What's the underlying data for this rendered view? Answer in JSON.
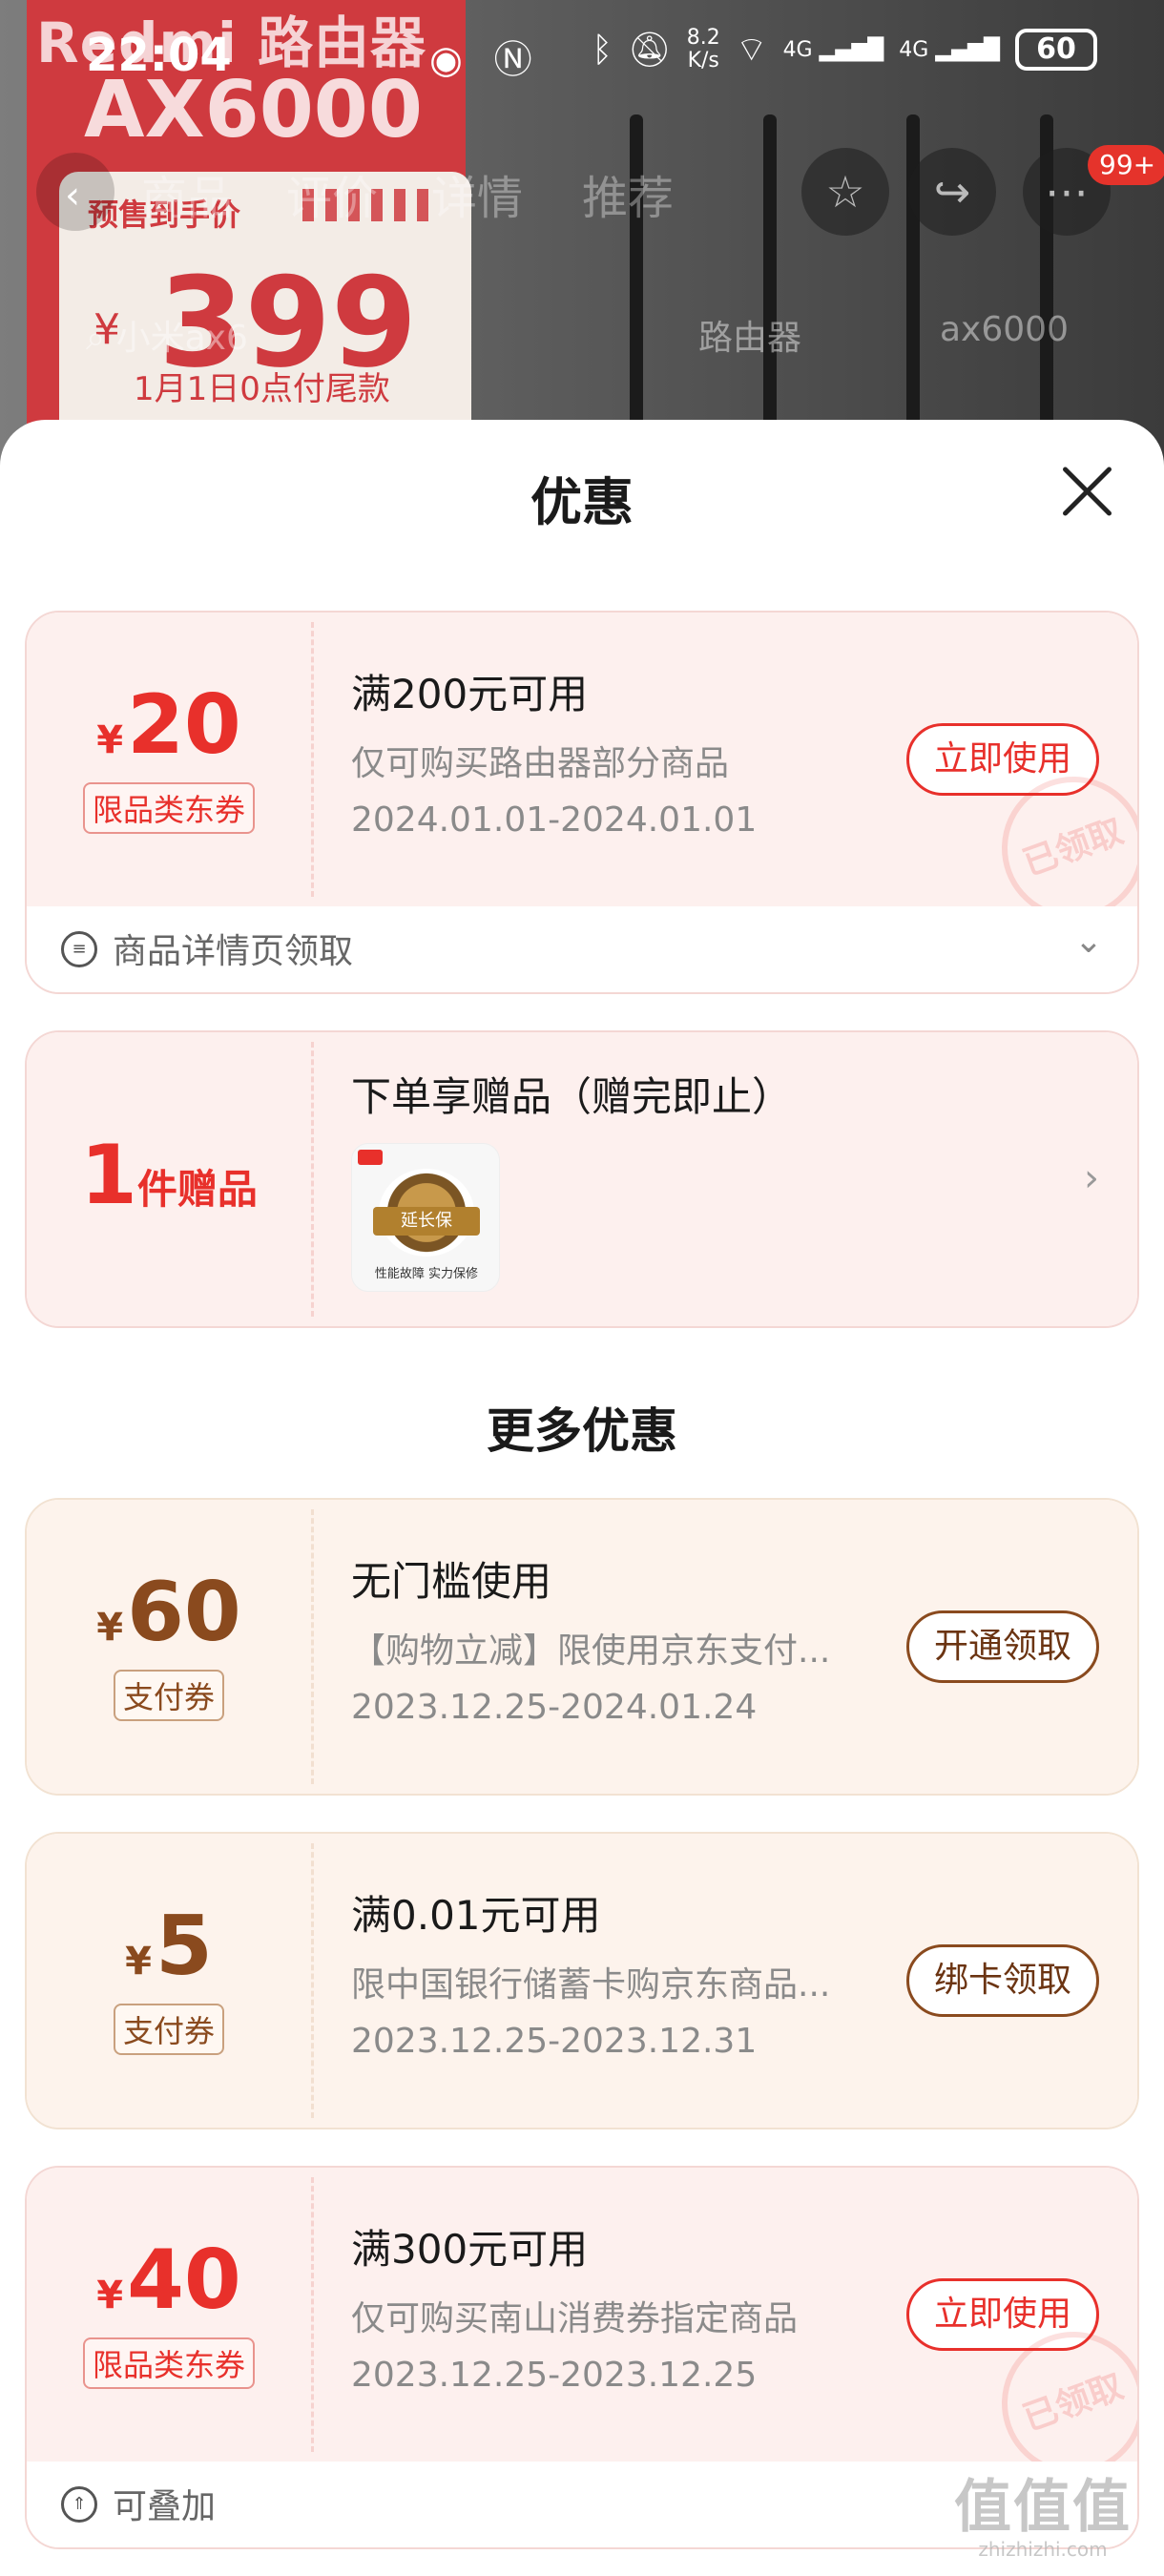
{
  "status_bar": {
    "time": "22:04",
    "net_speed_value": "8.2",
    "net_speed_unit": "K/s",
    "signal_1": "4G",
    "signal_2": "4G",
    "battery": "60"
  },
  "background_page": {
    "poster_brand": "Redmi 路由器",
    "poster_model": "AX6000",
    "presale_title": "预售到手价",
    "presale_yen": "¥",
    "presale_price": "399",
    "presale_note": "1月1日0点付尾款",
    "tabs": [
      "商品",
      "评价",
      "详情",
      "推荐"
    ],
    "notification_count": "99+",
    "search_text": "小米ax6",
    "search_chips": [
      "路由器",
      "ax6000"
    ]
  },
  "sheet": {
    "title": "优惠",
    "more_section_title": "更多优惠"
  },
  "coupons_top": [
    {
      "currency": "¥",
      "amount": "20",
      "tag": "限品类东券",
      "condition": "满200元可用",
      "scope": "仅可购买路由器部分商品",
      "validity": "2024.01.01-2024.01.01",
      "action": "立即使用",
      "stamp": "已领取",
      "footer": "商品详情页领取"
    }
  ],
  "gift": {
    "count": "1",
    "unit": "件赠品",
    "title": "下单享赠品（赠完即止）",
    "thumb_label": "延长保",
    "thumb_caption": "性能故障 实力保修"
  },
  "coupons_more": [
    {
      "currency": "¥",
      "amount": "60",
      "tag": "支付券",
      "condition": "无门槛使用",
      "scope": "【购物立减】限使用京东支付...",
      "validity": "2023.12.25-2024.01.24",
      "action": "开通领取"
    },
    {
      "currency": "¥",
      "amount": "5",
      "tag": "支付券",
      "condition": "满0.01元可用",
      "scope": "限中国银行储蓄卡购京东商品...",
      "validity": "2023.12.25-2023.12.31",
      "action": "绑卡领取"
    },
    {
      "currency": "¥",
      "amount": "40",
      "tag": "限品类东券",
      "condition": "满300元可用",
      "scope": "仅可购买南山消费券指定商品",
      "validity": "2023.12.25-2023.12.25",
      "action": "立即使用",
      "stamp": "已领取",
      "footer": "可叠加"
    }
  ],
  "watermark": {
    "logo": "值值值",
    "site": "zhizhizhi.com"
  },
  "colors": {
    "accent_red": "#e8302b",
    "accent_brown": "#8a4a1e",
    "card_red_bg": "#fdf0ee",
    "card_brown_bg": "#fdf3ec"
  }
}
